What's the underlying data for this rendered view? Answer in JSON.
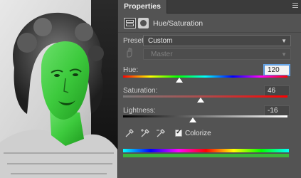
{
  "panel": {
    "tab_title": "Properties",
    "adjustment_title": "Hue/Saturation"
  },
  "preset": {
    "label": "Preset:",
    "value": "Custom"
  },
  "channel": {
    "value": "Master"
  },
  "hue": {
    "label": "Hue:",
    "value": "120",
    "range": [
      -180,
      180
    ]
  },
  "saturation": {
    "label": "Saturation:",
    "value": "46",
    "range": [
      -100,
      100
    ]
  },
  "lightness": {
    "label": "Lightness:",
    "value": "-16",
    "range": [
      -100,
      100
    ]
  },
  "colorize": {
    "label": "Colorize",
    "checked": true
  },
  "colors": {
    "panel_bg": "#535353",
    "focus": "#4a8fd8",
    "tint": "#3cd23c"
  },
  "icons": [
    "adjustment-layer-icon",
    "mask-icon",
    "targeted-adjust-hand-icon",
    "eyedropper-icon",
    "eyedropper-plus-icon",
    "eyedropper-minus-icon",
    "panel-menu-icon"
  ]
}
